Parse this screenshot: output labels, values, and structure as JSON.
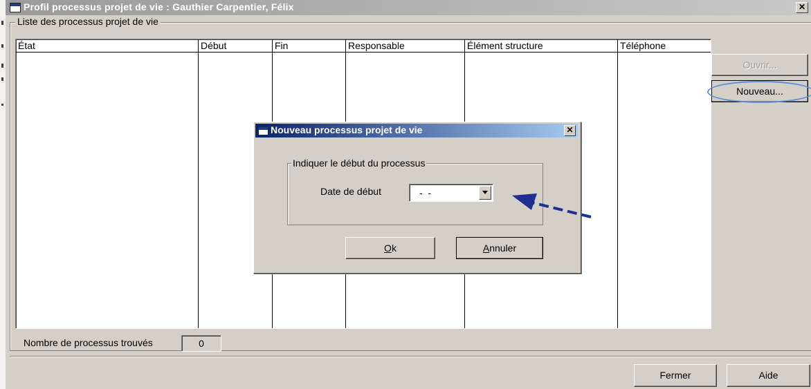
{
  "window": {
    "title": "Profil processus projet de vie : Gauthier Carpentier, Félix",
    "close_glyph": "✕"
  },
  "group": {
    "label": "Liste des processus projet de vie"
  },
  "list": {
    "columns": [
      "État",
      "Début",
      "Fin",
      "Responsable",
      "Élément structure",
      "Téléphone"
    ]
  },
  "side_buttons": {
    "ouvrir": "Ouvrir...",
    "nouveau": "Nouveau..."
  },
  "footer": {
    "count_label": "Nombre de processus trouvés",
    "count_value": "0",
    "fermer": "Fermer",
    "aide": "Aide"
  },
  "dialog": {
    "title": "Nouveau processus projet de vie",
    "close_glyph": "✕",
    "group_label": "Indiquer le début du processus",
    "date_label": "Date de début",
    "date_value": "- -",
    "ok_rest": "k",
    "ok_mnemonic": "O",
    "annuler_mnemonic": "A",
    "annuler_rest": "nnuler"
  },
  "colors": {
    "annotation_arrow": "#1f2f8f",
    "highlight_ring": "#5b8ed6"
  }
}
